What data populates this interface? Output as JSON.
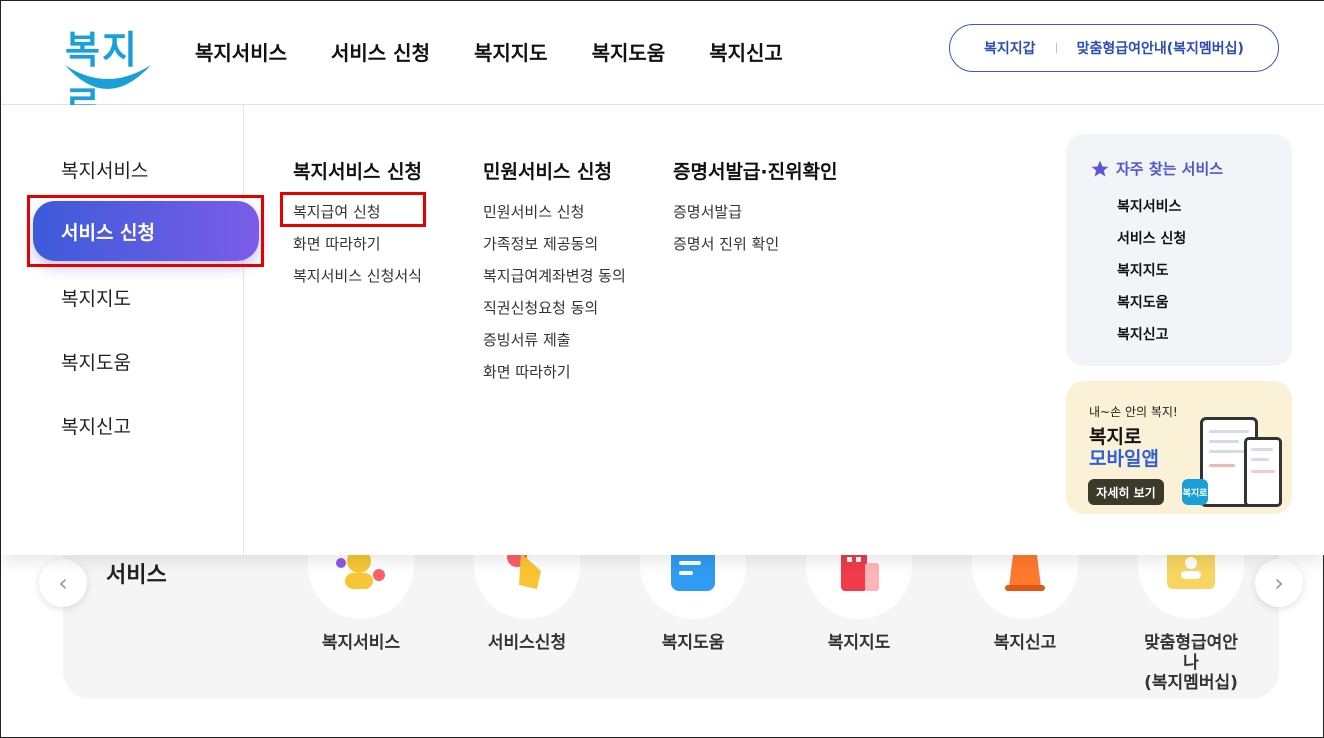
{
  "header": {
    "logo_text": "복지로",
    "nav": [
      "복지서비스",
      "서비스 신청",
      "복지지도",
      "복지도움",
      "복지신고"
    ],
    "util_links": [
      "복지지갑",
      "맞춤형급여안내(복지멤버십)"
    ]
  },
  "background": {
    "section_title": "서비스",
    "cards": [
      "복지서비스",
      "서비스신청",
      "복지도움",
      "복지지도",
      "복지신고",
      "맞춤형급여안나\n(복지멤버십)"
    ]
  },
  "mega_menu": {
    "lnb": {
      "items": [
        "복지서비스",
        "서비스 신청",
        "복지지도",
        "복지도움",
        "복지신고"
      ],
      "active": "서비스 신청"
    },
    "columns": [
      {
        "title": "복지서비스 신청",
        "links": [
          "복지급여 신청",
          "화면 따라하기",
          "복지서비스 신청서식"
        ]
      },
      {
        "title": "민원서비스 신청",
        "links": [
          "민원서비스 신청",
          "가족정보 제공동의",
          "복지급여계좌변경 동의",
          "직권신청요청 동의",
          "증빙서류 제출",
          "화면 따라하기"
        ]
      },
      {
        "title": "증명서발급·진위확인",
        "links": [
          "증명서발급",
          "증명서 진위 확인"
        ]
      }
    ],
    "favorites": {
      "title": "자주 찾는 서비스",
      "links": [
        "복지서비스",
        "서비스 신청",
        "복지지도",
        "복지도움",
        "복지신고"
      ]
    },
    "banner": {
      "small": "내~손 안의 복지!",
      "title1": "복지로",
      "title2": "모바일앱",
      "button": "자세히 보기",
      "mini_logo": "복지로"
    }
  },
  "colors": {
    "brand_blue": "#1aa0d8",
    "active_gradient_start": "#3c5bd9",
    "active_gradient_end": "#7b5ce8",
    "highlight_red": "#e60000",
    "util_border": "#3a57c7"
  }
}
